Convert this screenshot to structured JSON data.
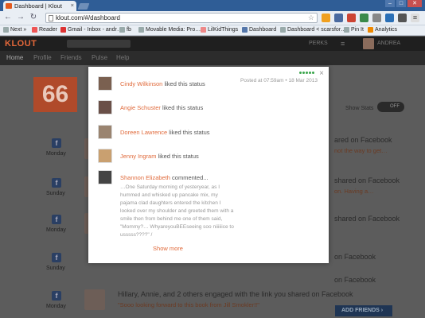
{
  "browser": {
    "tab_title": "Dashboard | Klout",
    "tab_close": "×",
    "url": "klout.com/#/dashboard",
    "bookmarks": [
      "Next »",
      "Reader",
      "Gmail - Inbox - andr…",
      "fb",
      "Movable Media: Pro…",
      "LilKidThings",
      "Dashboard",
      "Dashboard < scarsfor…",
      "Pin It",
      "Analytics"
    ]
  },
  "klout": {
    "logo": "KLOUT",
    "perks": "PERKS",
    "user": "ANDREA",
    "nav": [
      "Home",
      "Profile",
      "Friends",
      "Pulse",
      "Help"
    ],
    "score": "66",
    "show_stats_label": "Show Stats",
    "toggle_label": "OFF",
    "add_friends_label": "ADD FRIENDS",
    "feed_days": [
      "Monday",
      "Sunday",
      "Monday",
      "Sunday",
      "Monday"
    ],
    "feed_snippets": [
      "ared on Facebook",
      "not the way to get…",
      "shared on Facebook",
      "on. Having a…",
      "shared on Facebook",
      "on Facebook",
      "on Facebook",
      "Hillary, Annie, and 2 others engaged with the link you shared on Facebook",
      "\"Sooo looking forward to this book from Jill Smokler!!\""
    ]
  },
  "modal": {
    "close": "×",
    "posted": "Posted at 07:59am • 18 Mar 2013",
    "items": [
      {
        "name": "Cindy Wilkinson",
        "action": " liked this status"
      },
      {
        "name": "Angie Schuster",
        "action": " liked this status"
      },
      {
        "name": "Doreen Lawrence",
        "action": " liked this status"
      },
      {
        "name": "Jenny Ingram",
        "action": " liked this status"
      },
      {
        "name": "Shannon Elizabeth",
        "action": " commented..."
      }
    ],
    "comment": "…One Saturday morning of yesteryear, as I\nhummed and whisked up pancake mix, my\npajama clad daughters entered the kitchen I\nlooked over my shoulder and greeted them with a\nsmile then from behind me one of them said,\n\"Mommy?… WhyareyouBEEseeing soo niiiiiice to\nusssss????\"  /",
    "show_more": "Show more"
  },
  "colors": {
    "klout_orange": "#e06a3b",
    "chrome_blue": "#2f5d96",
    "online_green": "#3aa64b"
  }
}
